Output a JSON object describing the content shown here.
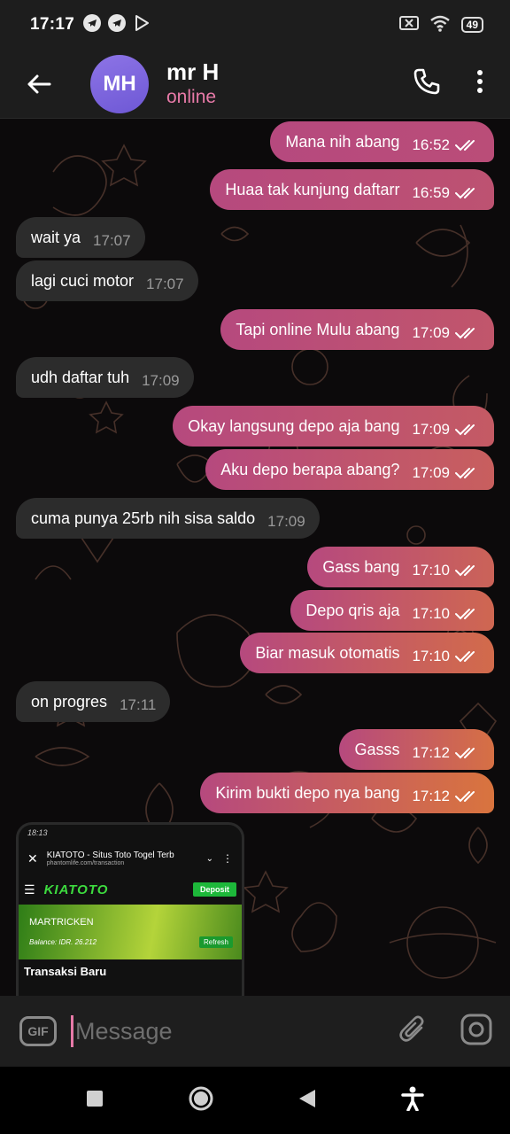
{
  "statusbar": {
    "time": "17:17",
    "battery": "49"
  },
  "header": {
    "avatar_initials": "MH",
    "name": "mr H",
    "status": "online"
  },
  "messages": [
    {
      "dir": "out",
      "text": "Mana nih abang",
      "time": "16:52"
    },
    {
      "dir": "out",
      "text": "Huaa tak kunjung daftarr",
      "time": "16:59"
    },
    {
      "dir": "in",
      "text": "wait ya",
      "time": "17:07"
    },
    {
      "dir": "in",
      "text": "lagi cuci motor",
      "time": "17:07"
    },
    {
      "dir": "out",
      "text": "Tapi online Mulu abang",
      "time": "17:09"
    },
    {
      "dir": "in",
      "text": "udh daftar tuh",
      "time": "17:09"
    },
    {
      "dir": "out",
      "text": "Okay langsung depo aja bang",
      "time": "17:09"
    },
    {
      "dir": "out",
      "text": "Aku depo berapa abang?",
      "time": "17:09"
    },
    {
      "dir": "in",
      "text": "cuma punya 25rb nih sisa saldo",
      "time": "17:09"
    },
    {
      "dir": "out",
      "text": "Gass bang",
      "time": "17:10"
    },
    {
      "dir": "out",
      "text": "Depo qris aja",
      "time": "17:10"
    },
    {
      "dir": "out",
      "text": "Biar masuk otomatis",
      "time": "17:10"
    },
    {
      "dir": "in",
      "text": "on progres",
      "time": "17:11"
    },
    {
      "dir": "out",
      "text": "Gasss",
      "time": "17:12"
    },
    {
      "dir": "out",
      "text": "Kirim bukti depo nya bang",
      "time": "17:12"
    }
  ],
  "preview": {
    "status_time": "18:13",
    "page_title": "KIATOTO - Situs Toto Togel Terb",
    "page_url": "phantomlife.com/transaction",
    "logo": "KIATOTO",
    "deposit": "Deposit",
    "member": "MARTRICKEN",
    "balance": "Balance: IDR. 26.212",
    "refresh": "Refresh",
    "section": "Transaksi Baru"
  },
  "input": {
    "gif_label": "GIF",
    "placeholder": "Message"
  },
  "colors": {
    "out_gradient_start": "#b6497e",
    "out_gradient_end": "#d9743e",
    "in_bubble": "#2c2c2c",
    "accent": "#e87aa8",
    "avatar": "#7b65dc"
  }
}
